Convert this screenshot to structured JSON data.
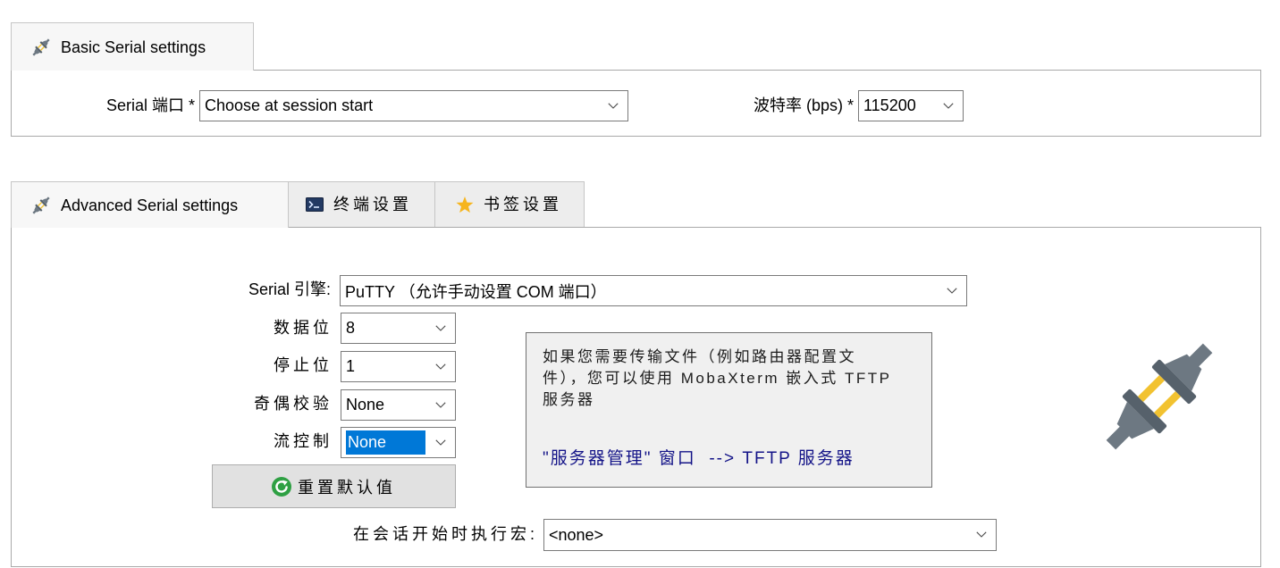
{
  "basic": {
    "tab": {
      "label": "Basic Serial settings",
      "icon": "plug-icon"
    },
    "serial_port": {
      "label": "Serial 端口 *",
      "value": "Choose at session start"
    },
    "baud_rate": {
      "label": "波特率 (bps) *",
      "value": "115200"
    }
  },
  "advanced_tabs": [
    {
      "label": "Advanced Serial settings",
      "icon": "plug-icon",
      "active": true
    },
    {
      "label": "终端设置",
      "icon": "terminal-icon",
      "active": false
    },
    {
      "label": "书签设置",
      "icon": "star-icon",
      "active": false
    }
  ],
  "advanced": {
    "serial_engine": {
      "label": "Serial 引擎:",
      "value": "PuTTY （允许手动设置 COM 端口）"
    },
    "data_bits": {
      "label": "数据位",
      "value": "8"
    },
    "stop_bits": {
      "label": "停止位",
      "value": "1"
    },
    "parity": {
      "label": "奇偶校验",
      "value": "None"
    },
    "flow_control": {
      "label": "流控制",
      "value": "None",
      "highlighted": true
    },
    "reset_button": {
      "label": "重置默认值",
      "icon": "refresh-icon"
    },
    "info_box": {
      "lines": [
        "如果您需要传输文件（例如路由器配置文",
        "件），您可以使用 MobaXterm 嵌入式 TFTP",
        "服务器"
      ],
      "link": "\"服务器管理\" 窗口  --> TFTP 服务器"
    },
    "decoration_icon": "plug-icon",
    "macro": {
      "label": "在会话开始时执行宏:",
      "value": "<none>"
    }
  },
  "colors": {
    "selection": "#0078d7",
    "link": "#141488",
    "plug_yellow": "#f2c230",
    "plug_gray": "#6d7882",
    "plug_dark": "#56616b",
    "star": "#f6b51e",
    "refresh": "#2ea043",
    "terminal_icon": "#233a63"
  }
}
